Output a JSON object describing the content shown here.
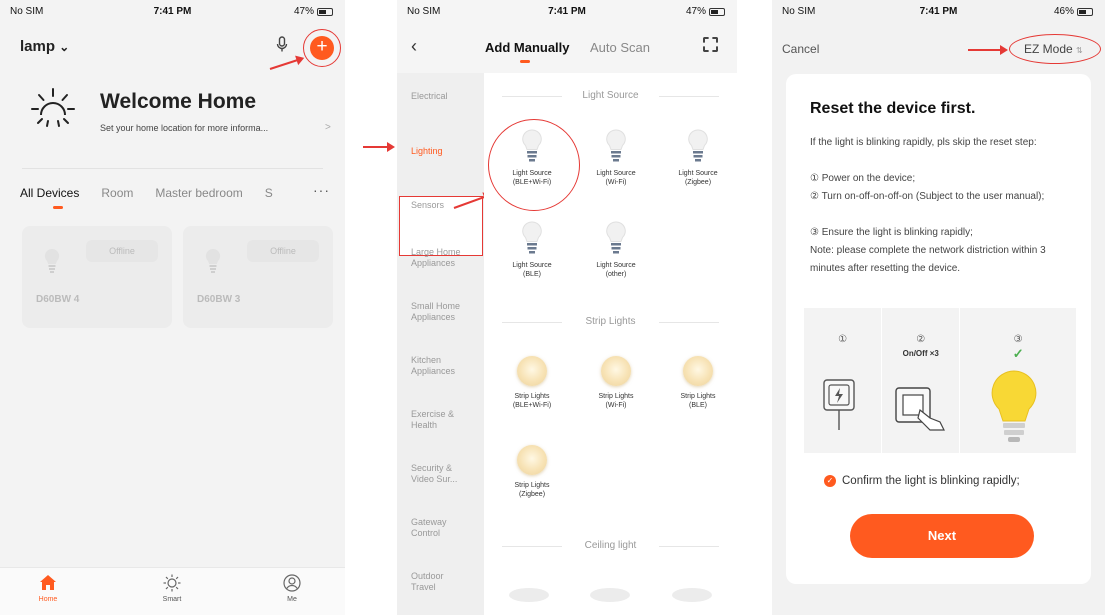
{
  "status_bars": [
    {
      "carrier": "No SIM",
      "time": "7:41 PM",
      "battery": "47%"
    },
    {
      "carrier": "No SIM",
      "time": "7:41 PM",
      "battery": "47%"
    },
    {
      "carrier": "No SIM",
      "time": "7:41 PM",
      "battery": "46%"
    }
  ],
  "home": {
    "home_name": "lamp",
    "chevron": "⌄",
    "welcome": "Welcome Home",
    "location_hint": "Set your home location for more informa...",
    "location_arrow": ">",
    "tabs": [
      "All Devices",
      "Room",
      "Master bedroom",
      "S"
    ],
    "more_icon": "···",
    "devices": [
      {
        "name": "D60BW 4",
        "status": "Offline"
      },
      {
        "name": "D60BW 3",
        "status": "Offline"
      }
    ],
    "tabbar": [
      {
        "label": "Home",
        "icon": "house-icon",
        "active": true
      },
      {
        "label": "Smart",
        "icon": "sun-icon",
        "active": false
      },
      {
        "label": "Me",
        "icon": "user-icon",
        "active": false
      }
    ]
  },
  "add_device": {
    "back_icon": "‹",
    "tab_manual": "Add Manually",
    "tab_auto": "Auto Scan",
    "categories": [
      "Electrical",
      "Lighting",
      "Sensors",
      "Large Home Appliances",
      "Small Home Appliances",
      "Kitchen Appliances",
      "Exercise & Health",
      "Security & Video Sur...",
      "Gateway Control",
      "Outdoor Travel"
    ],
    "active_category": "Lighting",
    "sections": {
      "light_source": "Light Source",
      "strip_lights": "Strip Lights",
      "ceiling_light": "Ceiling light"
    },
    "light_products": [
      [
        "Light Source",
        "(BLE+Wi-Fi)"
      ],
      [
        "Light Source",
        "(Wi-Fi)"
      ],
      [
        "Light Source",
        "(Zigbee)"
      ],
      [
        "Light Source",
        "(BLE)"
      ],
      [
        "Light Source",
        "(other)"
      ]
    ],
    "strip_products": [
      [
        "Strip Lights",
        "(BLE+Wi-Fi)"
      ],
      [
        "Strip Lights",
        "(Wi-Fi)"
      ],
      [
        "Strip Lights",
        "(BLE)"
      ],
      [
        "Strip Lights",
        "(Zigbee)"
      ]
    ]
  },
  "reset": {
    "cancel": "Cancel",
    "mode": "EZ Mode",
    "mode_icon": "⇅",
    "title": "Reset the device first.",
    "intro": "If the light is blinking rapidly, pls skip the reset step:",
    "steps_text": [
      "① Power on the device;",
      "② Turn on-off-on-off-on (Subject to the user manual);",
      "③ Ensure the light is blinking rapidly;"
    ],
    "note": "Note: please complete the network distriction within 3 minutes after resetting the device.",
    "illus_steps": [
      {
        "num": "①",
        "sub": ""
      },
      {
        "num": "②",
        "sub": "On/Off ×3"
      },
      {
        "num": "③",
        "sub": "✓"
      }
    ],
    "confirm": "Confirm the light is blinking rapidly;",
    "confirm_icon": "✓",
    "next": "Next"
  },
  "colors": {
    "accent": "#ff5a1f",
    "annotation": "#e53935"
  }
}
